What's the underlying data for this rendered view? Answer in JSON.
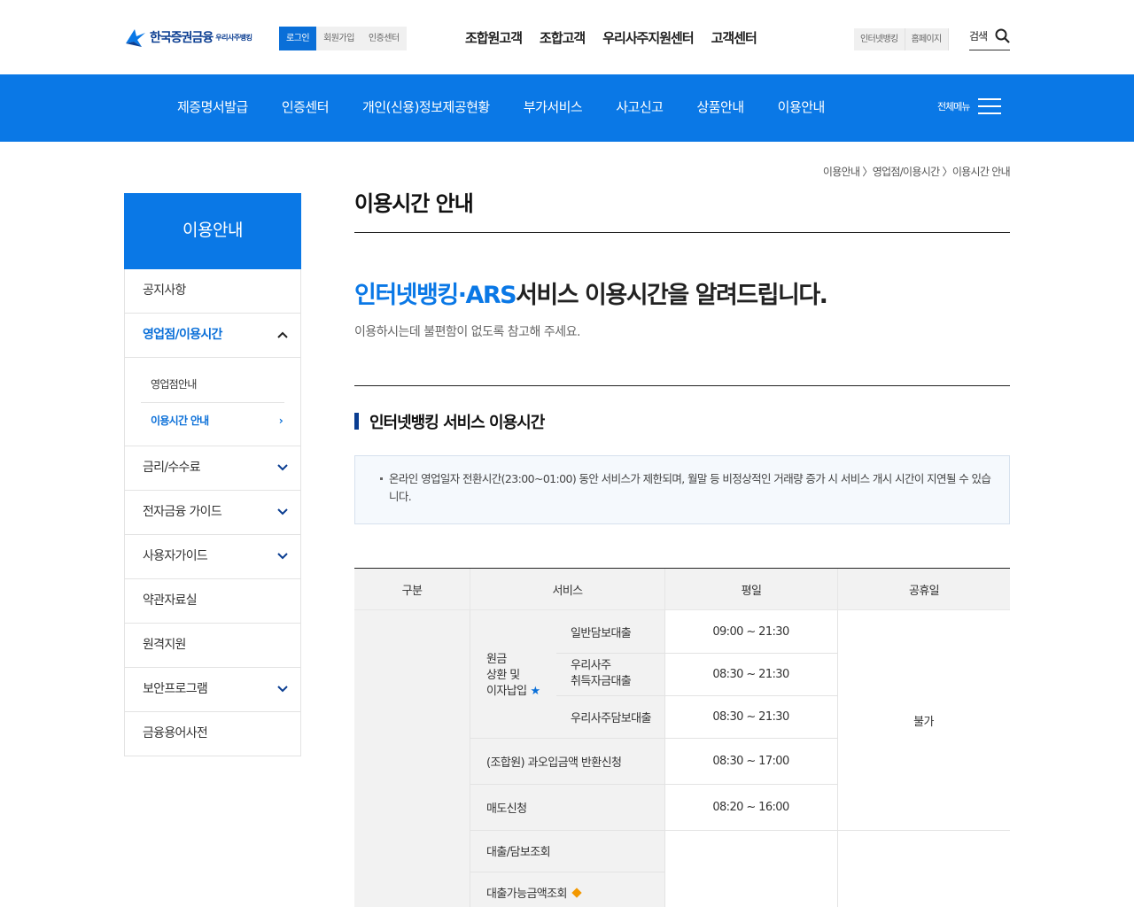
{
  "header": {
    "logo": {
      "main": "한국증권금융",
      "sub": "우리사주뱅킹"
    },
    "auth": [
      "로그인",
      "회원가입",
      "인증센터"
    ],
    "top_menu": [
      "조합원고객",
      "조합고객",
      "우리사주지원센터",
      "고객센터"
    ],
    "util": [
      "인터넷뱅킹",
      "홈페이지"
    ],
    "search_label": "검색"
  },
  "gnb": {
    "items": [
      "제증명서발급",
      "인증센터",
      "개인(신용)정보제공현황",
      "부가서비스",
      "사고신고",
      "상품안내",
      "이용안내"
    ],
    "all_menu": "전체메뉴"
  },
  "breadcrumb": "이용안내 〉영업점/이용시간 〉이용시간 안내",
  "lnb": {
    "title": "이용안내",
    "items": [
      "공지사항",
      "영업점/이용시간",
      "금리/수수료",
      "전자금융 가이드",
      "사용자가이드",
      "약관자료실",
      "원격지원",
      "보안프로그램",
      "금융용어사전"
    ],
    "sub_items": [
      "영업점안내",
      "이용시간 안내"
    ]
  },
  "content": {
    "page_title": "이용시간 안내",
    "headline_highlight": "인터넷뱅킹·ARS",
    "headline_rest": "서비스 이용시간을 알려드립니다.",
    "subhead": "이용하시는데 불편함이 없도록 참고해 주세요.",
    "section_title": "인터넷뱅킹 서비스 이용시간",
    "notice": "온라인 영업일자 전환시간(23:00~01:00) 동안 서비스가 제한되며, 월말 등 비정상적인 거래량 증가 시 서비스 개시 시간이 지연될 수 있습니다."
  },
  "table": {
    "headers": [
      "구분",
      "서비스",
      "평일",
      "공휴일"
    ],
    "group_label_line1": "원금",
    "group_label_line2": "상환 및",
    "group_label_line3": "이자납입",
    "group_rows": [
      {
        "service_line1": "일반담보대출",
        "service_line2": "",
        "weekday": "09:00 ~ 21:30"
      },
      {
        "service_line1": "우리사주",
        "service_line2": "취득자금대출",
        "weekday": "08:30 ~ 21:30"
      },
      {
        "service_line1": "우리사주담보대출",
        "service_line2": "",
        "weekday": "08:30 ~ 21:30"
      }
    ],
    "rows": [
      {
        "service": "(조합원) 과오입금액 반환신청",
        "weekday": "08:30 ~ 17:00"
      },
      {
        "service": "매도신청",
        "weekday": "08:20 ~ 16:00"
      },
      {
        "service": "대출/담보조회",
        "weekday": ""
      },
      {
        "service": "대출가능금액조회",
        "weekday": ""
      }
    ],
    "holiday": "불가"
  },
  "colors": {
    "brand_blue": "#0a78e6",
    "accent_orange": "#f39800"
  }
}
